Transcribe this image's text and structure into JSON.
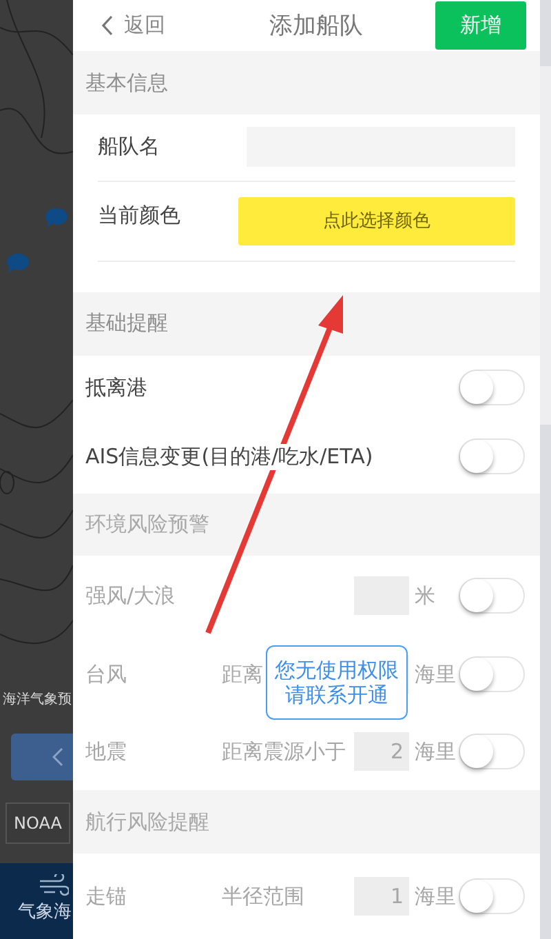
{
  "background": {
    "map_caption": "海洋气象预",
    "source_select": "NOAA",
    "nav_label": "气象海"
  },
  "header": {
    "back": "返回",
    "title": "添加船队",
    "action": "新增"
  },
  "sections": [
    {
      "title": "基本信息",
      "disabled": false,
      "rows": [
        {
          "kind": "input",
          "label": "船队名"
        },
        {
          "kind": "color",
          "label": "当前颜色",
          "button": "点此选择颜色",
          "color": "#ffeb3b"
        }
      ]
    },
    {
      "title": "基础提醒",
      "disabled": false,
      "rows": [
        {
          "kind": "toggle",
          "label": "抵离港",
          "on": false
        },
        {
          "kind": "toggle",
          "label": "AIS信息变更(目的港/吃水/ETA)",
          "on": false
        }
      ]
    },
    {
      "title": "环境风险预警",
      "disabled": true,
      "rows": [
        {
          "kind": "threshold",
          "label": "强风/大浪",
          "unit": "米",
          "on": false
        },
        {
          "kind": "threshold",
          "label": "台风",
          "condition": "距离",
          "unit": "海里",
          "on": false
        },
        {
          "kind": "threshold",
          "label": "地震",
          "condition": "距离震源小于",
          "value": "2",
          "unit": "海里",
          "on": false
        }
      ]
    },
    {
      "title": "航行风险提醒",
      "disabled": true,
      "rows": [
        {
          "kind": "threshold",
          "label": "走锚",
          "condition": "半径范围",
          "value": "1",
          "unit": "海里",
          "on": false
        }
      ]
    }
  ],
  "toast": {
    "lines": [
      "您无使用权限",
      "请联系开通"
    ]
  }
}
